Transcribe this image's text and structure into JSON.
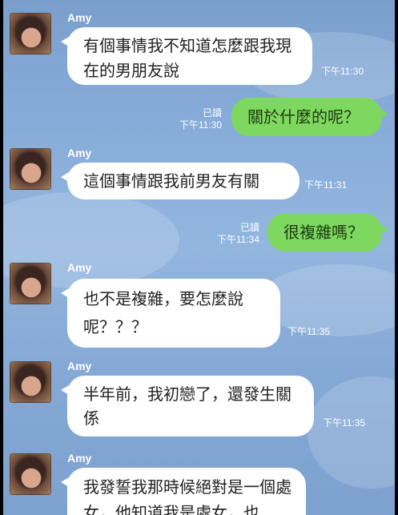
{
  "conversation": {
    "messages": [
      {
        "sender": "Amy",
        "text": "有個事情我不知道怎麼跟我現在的男朋友說",
        "time": "下午11:30"
      },
      {
        "status": "已讀",
        "time": "下午11:30",
        "text": "關於什麼的呢？"
      },
      {
        "sender": "Amy",
        "text": "這個事情跟我前男友有關",
        "time": "下午11:31"
      },
      {
        "status": "已讀",
        "time": "下午11:34",
        "text": "很複雜嗎？"
      },
      {
        "sender": "Amy",
        "text": "也不是複雜，要怎麼說呢？？？",
        "time": "下午11:35"
      },
      {
        "sender": "Amy",
        "text": "半年前，我初戀了，還發生關係",
        "time": "下午11:35"
      },
      {
        "sender": "Amy",
        "text": "我發誓我那時候絕對是一個處女，他知道我是處女，也",
        "time": ""
      }
    ]
  }
}
